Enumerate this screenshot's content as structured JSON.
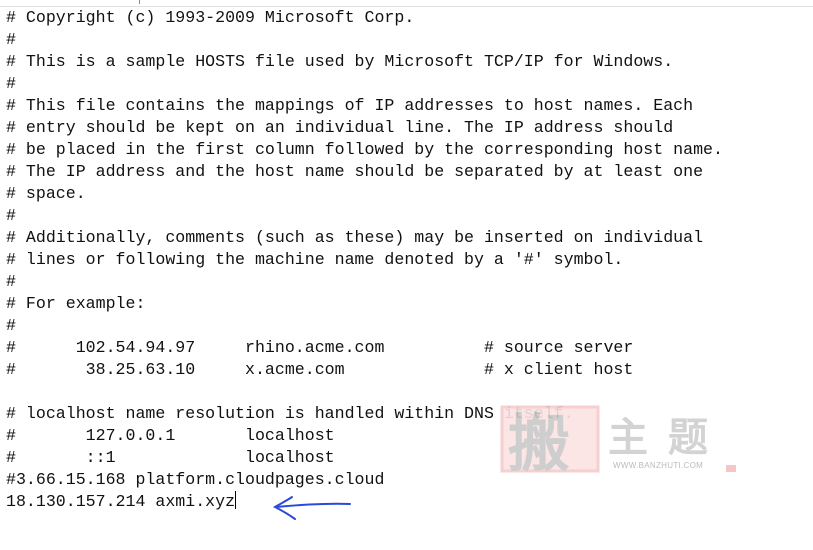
{
  "editor": {
    "lines": [
      "# Copyright (c) 1993-2009 Microsoft Corp.",
      "#",
      "# This is a sample HOSTS file used by Microsoft TCP/IP for Windows.",
      "#",
      "# This file contains the mappings of IP addresses to host names. Each",
      "# entry should be kept on an individual line. The IP address should",
      "# be placed in the first column followed by the corresponding host name.",
      "# The IP address and the host name should be separated by at least one",
      "# space.",
      "#",
      "# Additionally, comments (such as these) may be inserted on individual",
      "# lines or following the machine name denoted by a '#' symbol.",
      "#",
      "# For example:",
      "#",
      "#      102.54.94.97     rhino.acme.com          # source server",
      "#       38.25.63.10     x.acme.com              # x client host",
      "",
      "# localhost name resolution is handled within DNS itself.",
      "#       127.0.0.1       localhost",
      "#       ::1             localhost",
      "#3.66.15.168 platform.cloudpages.cloud",
      "18.130.157.214 axmi.xyz"
    ]
  },
  "watermark": {
    "text": "搬主题",
    "url_text": "WWW.BANZHUTI.COM"
  },
  "annotation": {
    "icon": "hand-drawn-arrow-left-icon",
    "color": "#2a4bd7"
  }
}
